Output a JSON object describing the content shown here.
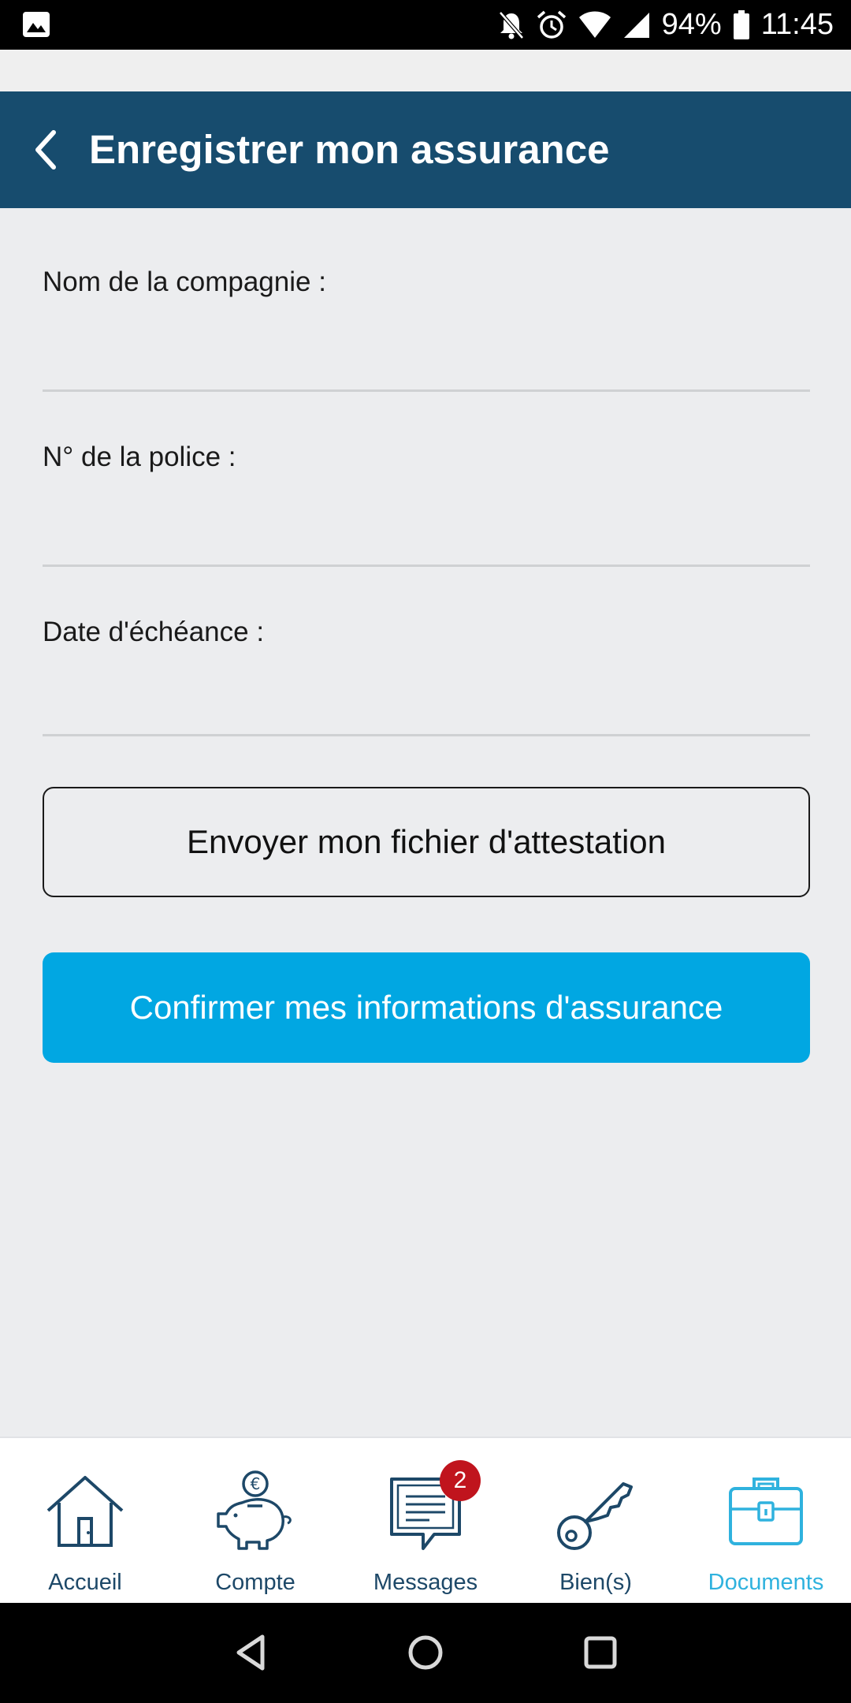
{
  "status_bar": {
    "battery": "94%",
    "time": "11:45",
    "icons": [
      "image-icon",
      "bell-off-icon",
      "alarm-icon",
      "wifi-icon",
      "signal-icon",
      "battery-icon"
    ]
  },
  "header": {
    "title": "Enregistrer mon assurance",
    "back_icon": "chevron-left-icon",
    "background": "#174c6e"
  },
  "form": {
    "company": {
      "label": "Nom de la compagnie :",
      "value": ""
    },
    "policy": {
      "label": "N° de la police :",
      "value": ""
    },
    "due_date": {
      "label": "Date d'échéance :",
      "value": ""
    },
    "upload_label": "Envoyer mon fichier d'attestation",
    "confirm_label": "Confirmer mes informations d'assurance",
    "confirm_color": "#01a7e2"
  },
  "bottom_nav": {
    "items": [
      {
        "label": "Accueil",
        "icon": "house-icon",
        "active": false
      },
      {
        "label": "Compte",
        "icon": "piggy-bank-icon",
        "active": false
      },
      {
        "label": "Messages",
        "icon": "message-icon",
        "active": false,
        "badge": "2"
      },
      {
        "label": "Bien(s)",
        "icon": "key-icon",
        "active": false
      },
      {
        "label": "Documents",
        "icon": "briefcase-icon",
        "active": true
      }
    ],
    "active_color": "#2fb2de",
    "inactive_color": "#1d4868"
  },
  "system_nav": [
    "back-triangle-icon",
    "home-circle-icon",
    "recents-square-icon"
  ]
}
